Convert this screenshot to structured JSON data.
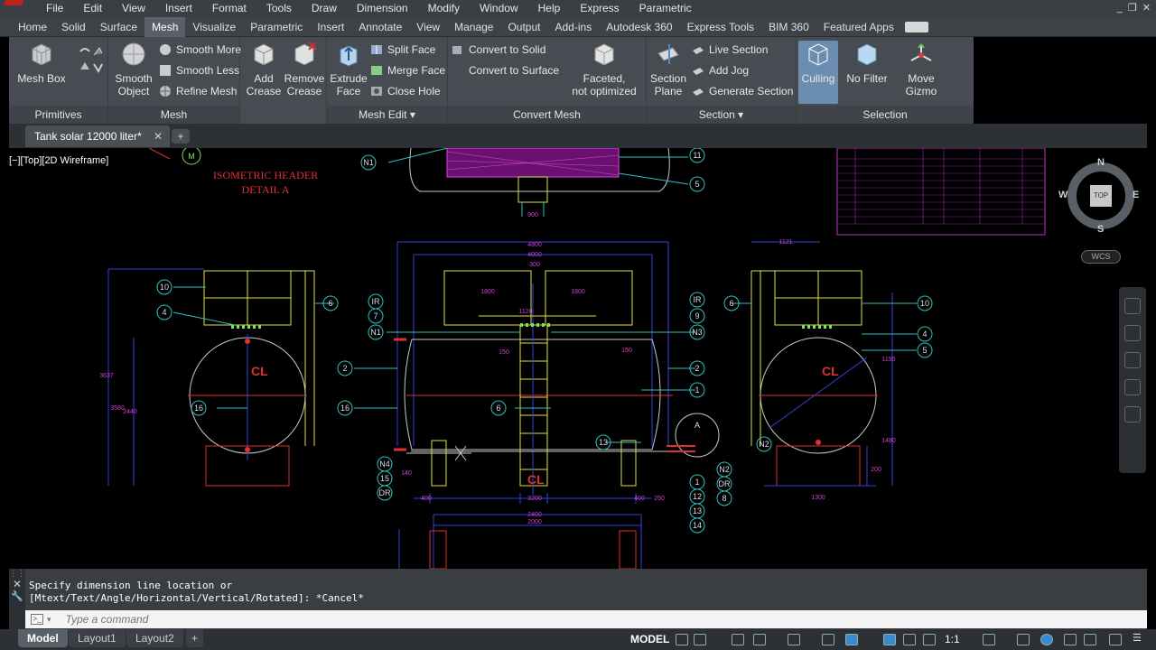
{
  "menubar": {
    "items": [
      "File",
      "Edit",
      "View",
      "Insert",
      "Format",
      "Tools",
      "Draw",
      "Dimension",
      "Modify",
      "Window",
      "Help",
      "Express",
      "Parametric"
    ],
    "window_controls": [
      "_",
      "❐",
      "✕"
    ]
  },
  "ribbon_tabs": [
    "Home",
    "Solid",
    "Surface",
    "Mesh",
    "Visualize",
    "Parametric",
    "Insert",
    "Annotate",
    "View",
    "Manage",
    "Output",
    "Add-ins",
    "Autodesk 360",
    "Express Tools",
    "BIM 360",
    "Featured Apps"
  ],
  "active_tab": "Mesh",
  "ribbon": {
    "primitives": {
      "title": "Primitives",
      "mesh_box": "Mesh Box"
    },
    "mesh": {
      "title": "Mesh",
      "smooth_object_1": "Smooth",
      "smooth_object_2": "Object",
      "smooth_more": "Smooth More",
      "smooth_less": "Smooth Less",
      "refine_mesh": "Refine Mesh"
    },
    "add_crease_1": "Add",
    "add_crease_2": "Crease",
    "remove_crease_1": "Remove",
    "remove_crease_2": "Crease",
    "mesh_edit": {
      "title": "Mesh Edit",
      "extrude_face_1": "Extrude",
      "extrude_face_2": "Face",
      "split_face": "Split Face",
      "merge_face": "Merge Face",
      "close_hole": "Close Hole"
    },
    "convert_mesh": {
      "title": "Convert Mesh",
      "convert_to_solid": "Convert to Solid",
      "convert_to_surface": "Convert to Surface",
      "faceted_1": "Faceted,",
      "faceted_2": "not optimized"
    },
    "section": {
      "title": "Section",
      "section_plane_1": "Section",
      "section_plane_2": "Plane",
      "live_section": "Live Section",
      "add_jog": "Add Jog",
      "generate_section": "Generate Section"
    },
    "selection": {
      "title": "Selection",
      "culling": "Culling",
      "no_filter": "No Filter",
      "move_gizmo_1": "Move",
      "move_gizmo_2": "Gizmo"
    }
  },
  "file_tab": {
    "name": "Tank solar 12000 liter*",
    "close": "✕",
    "new": "+"
  },
  "viewport": {
    "label": "[−][Top][2D Wireframe]",
    "compass": {
      "n": "N",
      "s": "S",
      "e": "E",
      "w": "W",
      "top": "TOP"
    },
    "wcs": "WCS"
  },
  "drawing": {
    "header_title_1": "ISOMETRIC HEADER",
    "header_title_2": "DETAIL  A",
    "dims": [
      "4800",
      "4000",
      "300",
      "1800",
      "1800",
      "1120",
      "3200",
      "400",
      "400",
      "250",
      "140",
      "2400",
      "2000",
      "1121",
      "1300",
      "1195",
      "1480",
      "200",
      "3637",
      "3580",
      "2440",
      "900",
      "150",
      "150"
    ],
    "bubbles_left": [
      "10",
      "4",
      "6",
      "2",
      "16"
    ],
    "bubbles_center_left": [
      "IR",
      "7",
      "N1",
      "2",
      "16",
      "6",
      "N4",
      "15",
      "DR"
    ],
    "bubbles_center_right": [
      "IR",
      "9",
      "N3",
      "2",
      "1",
      "13",
      "1",
      "12",
      "13",
      "14",
      "N2",
      "DR",
      "8"
    ],
    "bubbles_right": [
      "6",
      "10",
      "4",
      "5",
      "N2"
    ],
    "bubbles_top": [
      "M",
      "N1",
      "11",
      "5"
    ],
    "detail": "A",
    "cl": "CL"
  },
  "command": {
    "line1": "Specify dimension line location or",
    "line2": "[Mtext/Text/Angle/Horizontal/Vertical/Rotated]: *Cancel*",
    "placeholder": "Type a command"
  },
  "statusbar": {
    "tabs": [
      "Model",
      "Layout1",
      "Layout2"
    ],
    "add": "+",
    "model_btn": "MODEL",
    "scale": "1:1"
  }
}
